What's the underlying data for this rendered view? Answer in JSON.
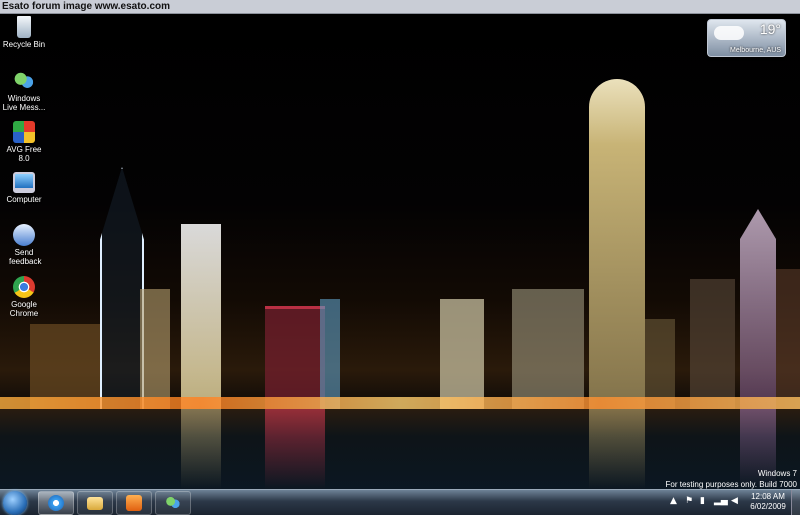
{
  "watermark": "Esato forum image www.esato.com",
  "desktop_icons": [
    {
      "id": "recycle-bin",
      "label": "Recycle Bin",
      "icon": "recycle-bin-icon"
    },
    {
      "id": "windows-live-messenger",
      "label": "Windows Live Mess...",
      "icon": "messenger-icon"
    },
    {
      "id": "avg-free",
      "label": "AVG Free 8.0",
      "icon": "avg-icon"
    },
    {
      "id": "computer",
      "label": "Computer",
      "icon": "computer-icon"
    },
    {
      "id": "send-feedback",
      "label": "Send feedback",
      "icon": "feedback-icon"
    },
    {
      "id": "google-chrome",
      "label": "Google Chrome",
      "icon": "chrome-icon"
    }
  ],
  "weather": {
    "temp": "19°",
    "location": "Melbourne, AUS"
  },
  "windows_badge": {
    "line1": "Windows  7",
    "line2": "For testing purposes only. Build 7000"
  },
  "taskbar": {
    "pinned": [
      {
        "name": "internet-explorer",
        "icon": "ie-icon",
        "active": true
      },
      {
        "name": "windows-explorer",
        "icon": "folder-icon",
        "active": false
      },
      {
        "name": "media-player",
        "icon": "media-player-icon",
        "active": false
      },
      {
        "name": "messenger",
        "icon": "messenger-icon",
        "active": false
      }
    ],
    "clock": {
      "time": "12:08 AM",
      "date": "6/02/2009"
    }
  },
  "colors": {
    "taskbar": "#2c3848",
    "accent": "#2b6fb8"
  }
}
